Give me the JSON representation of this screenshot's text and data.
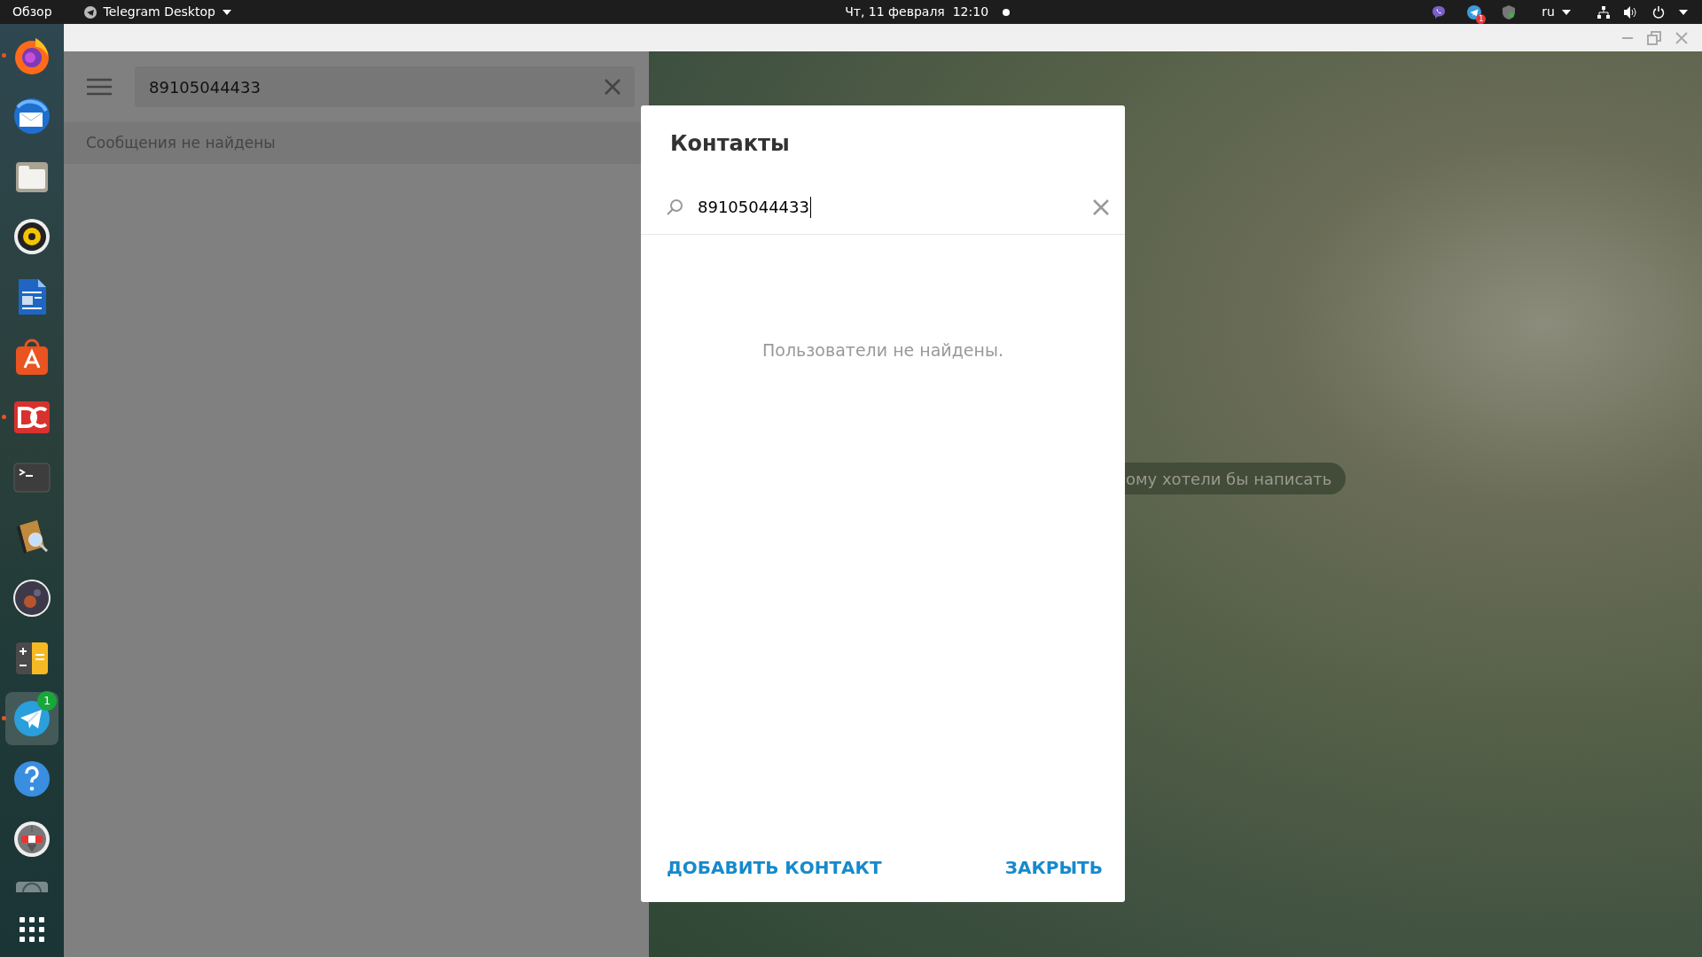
{
  "top_bar": {
    "activities": "Обзор",
    "app_menu": "Telegram Desktop",
    "clock": "Чт, 11 февраля  12:10",
    "tray_badge": "1",
    "language": "ru"
  },
  "dock": {
    "items": [
      {
        "kind": "firefox",
        "running": true,
        "selected": false
      },
      {
        "kind": "mail",
        "running": false,
        "selected": false
      },
      {
        "kind": "files",
        "running": false,
        "selected": false
      },
      {
        "kind": "speaker",
        "running": false,
        "selected": false
      },
      {
        "kind": "document",
        "running": false,
        "selected": false
      },
      {
        "kind": "store",
        "running": false,
        "selected": false
      },
      {
        "kind": "dc",
        "running": true,
        "selected": false
      },
      {
        "kind": "terminal",
        "running": false,
        "selected": false
      },
      {
        "kind": "dictionary",
        "running": false,
        "selected": false
      },
      {
        "kind": "sphere",
        "running": false,
        "selected": false
      },
      {
        "kind": "calculator",
        "running": false,
        "selected": false
      },
      {
        "kind": "telegram",
        "running": true,
        "selected": true,
        "badge": "1"
      },
      {
        "kind": "help",
        "running": false,
        "selected": false
      },
      {
        "kind": "lifebuoy",
        "running": false,
        "selected": false
      },
      {
        "kind": "partial",
        "running": false,
        "selected": false
      },
      {
        "kind": "grid",
        "running": false,
        "selected": false
      }
    ]
  },
  "chat_list": {
    "search": {
      "value": "89105044433"
    },
    "empty_text": "Сообщения не найдены"
  },
  "chat_area": {
    "hint": "ому хотели бы написать"
  },
  "dialog": {
    "title": "Контакты",
    "search": {
      "value": "89105044433"
    },
    "empty_text": "Пользователи не найдены.",
    "buttons": [
      "ДОБАВИТЬ КОНТАКТ",
      "ЗАКРЫТЬ"
    ]
  }
}
